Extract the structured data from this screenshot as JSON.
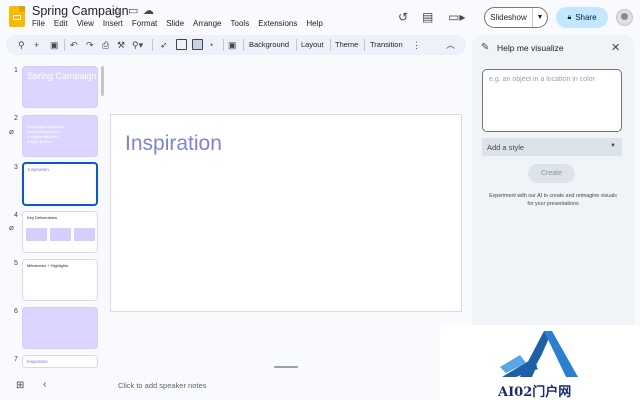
{
  "header": {
    "title": "Spring Campaign",
    "menu": [
      "File",
      "Edit",
      "View",
      "Insert",
      "Format",
      "Slide",
      "Arrange",
      "Tools",
      "Extensions",
      "Help"
    ],
    "slideshow_label": "Slideshow",
    "share_label": "Share"
  },
  "toolbar": {
    "background_label": "Background",
    "layout_label": "Layout",
    "theme_label": "Theme",
    "transition_label": "Transition"
  },
  "filmstrip": {
    "slides": [
      {
        "number": "1",
        "title": "Spring Campaign"
      },
      {
        "number": "2",
        "lines": [
          "A campaign that brings",
          "seasonal innovation",
          "to market with fresh",
          "design direction"
        ]
      },
      {
        "number": "3",
        "title": "Inspiration"
      },
      {
        "number": "4",
        "title": "Key Deliverables"
      },
      {
        "number": "5",
        "title": "Milestones + Highlights"
      },
      {
        "number": "6"
      },
      {
        "number": "7",
        "title": "Inspiration"
      }
    ]
  },
  "canvas": {
    "slide_title": "Inspiration",
    "notes_placeholder": "Click to add speaker notes"
  },
  "panel": {
    "title": "Help me visualize",
    "input_placeholder": "e.g. an object in a location in color",
    "style_label": "Add a style",
    "create_label": "Create",
    "description": "Experiment with our AI to create and reimagine visuals for your presentations"
  },
  "watermark": {
    "text": "AI02门户网"
  },
  "colors": {
    "accent": "#0b57d0",
    "share_bg": "#c2e7ff",
    "slide_title": "#7e83d6",
    "thumb_purple": "#dcd5ff"
  },
  "icons": [
    "star-icon",
    "move-folder-icon",
    "cloud-status-icon",
    "history-icon",
    "comment-icon",
    "video-call-icon",
    "avatar",
    "search-icon",
    "add-icon",
    "new-slide-icon",
    "undo-icon",
    "redo-icon",
    "print-icon",
    "paint-format-icon",
    "zoom-icon",
    "select-icon",
    "text-box-icon",
    "image-icon",
    "shape-icon",
    "comment-add-icon",
    "more-icon",
    "collapse-toolbar-icon",
    "pen-spark-icon",
    "close-icon",
    "attachment-icon",
    "grid-view-icon",
    "collapse-filmstrip-icon"
  ]
}
